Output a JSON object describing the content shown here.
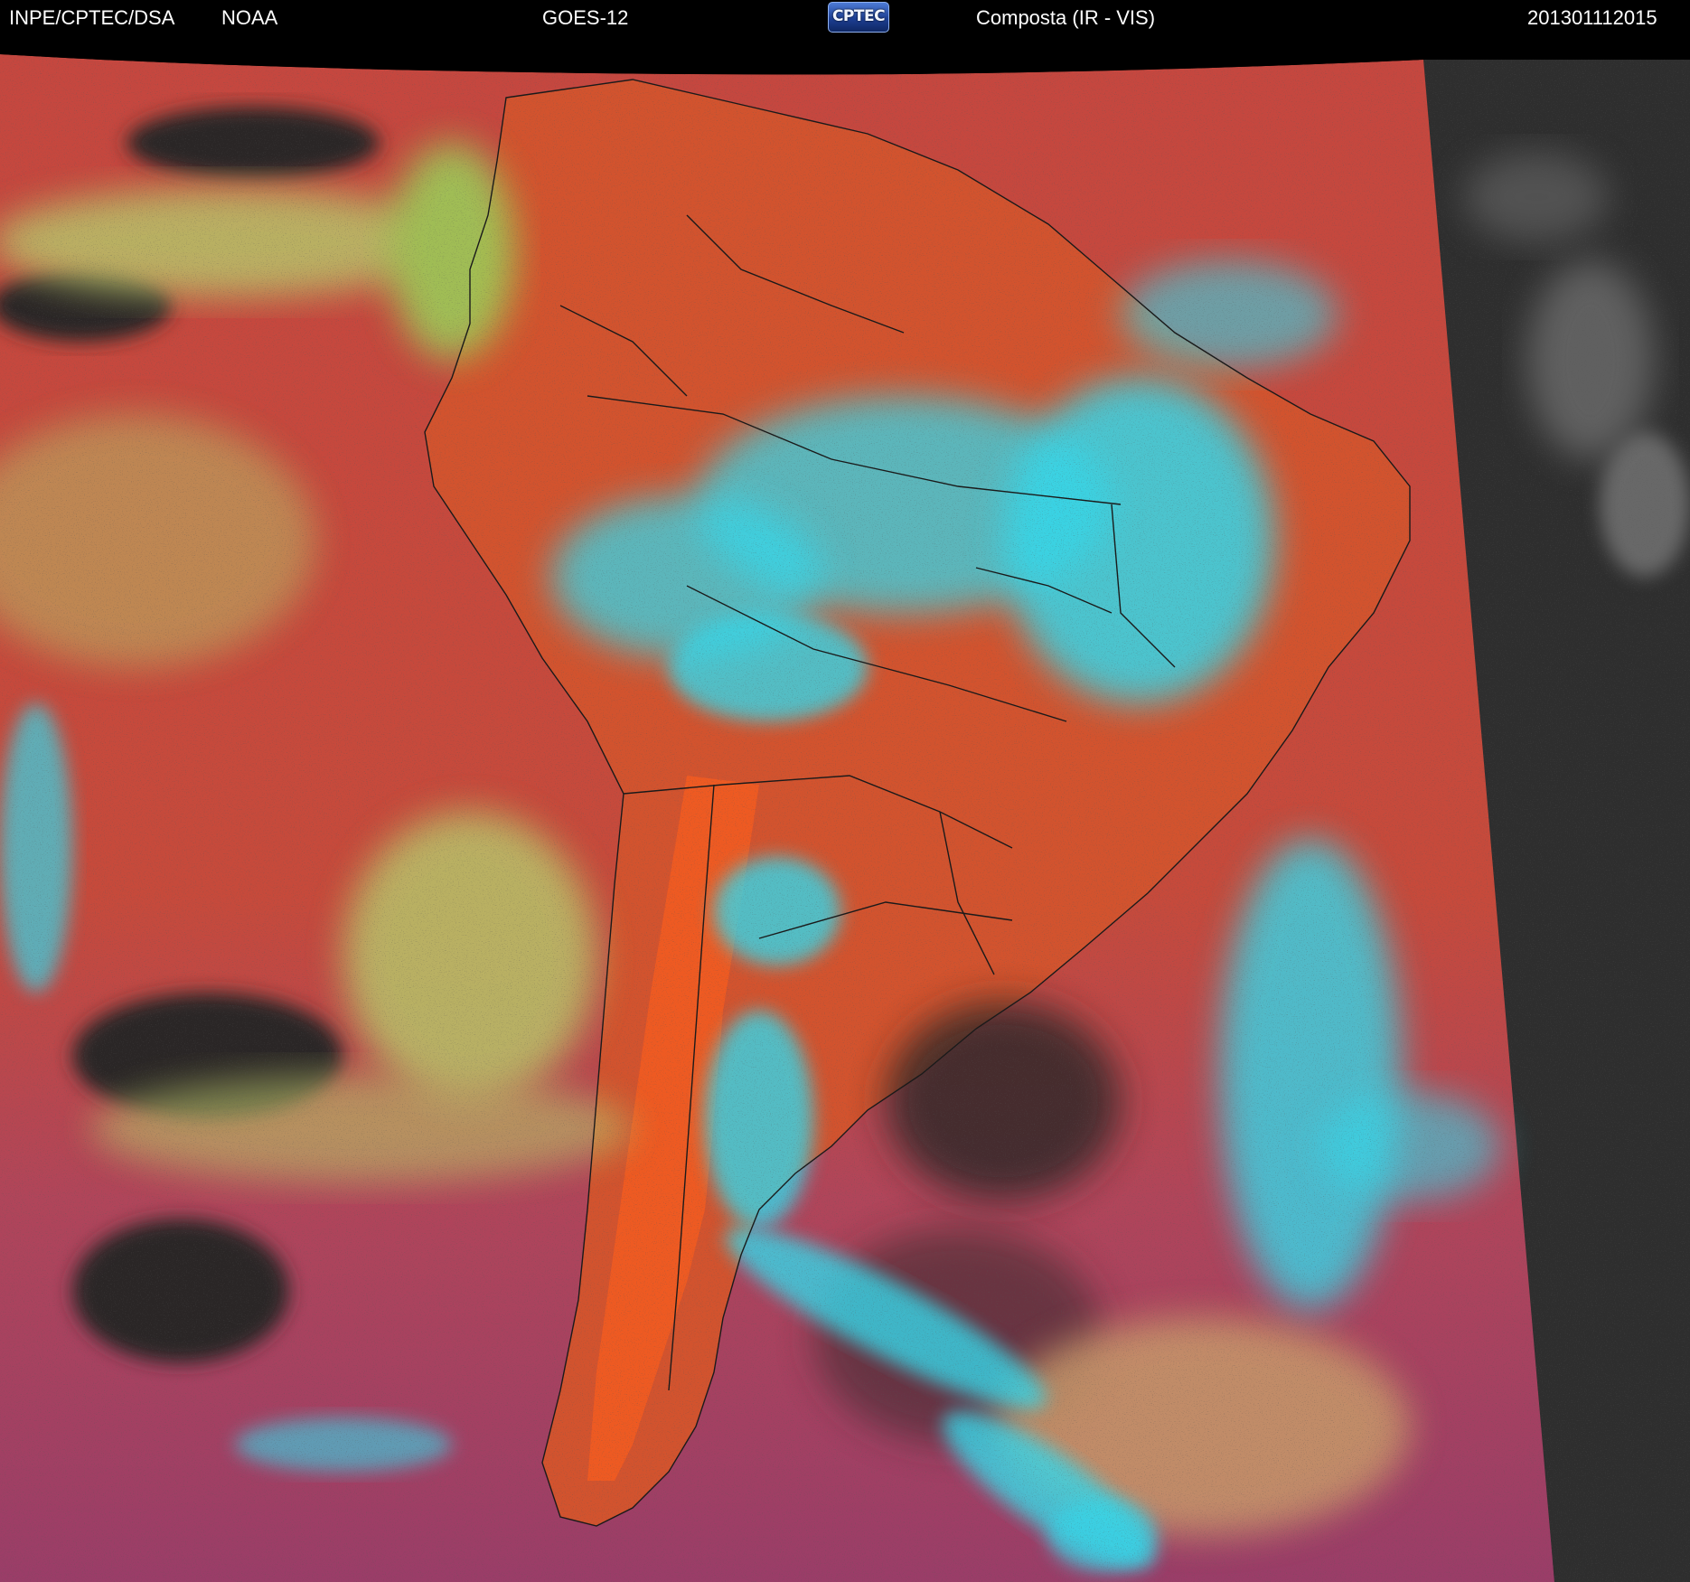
{
  "header": {
    "organization": "INPE/CPTEC/DSA",
    "agency": "NOAA",
    "satellite": "GOES-12",
    "logo_text": "CPTEC",
    "product": "Composta (IR - VIS)",
    "timestamp": "201301112015"
  },
  "palette": {
    "clear_ocean": "#c44a3e",
    "land_clear": "#d9542c",
    "cold_cloud": "#33d9e8",
    "mid_cloud": "#9ad35a",
    "low_cloud": "#c9c070",
    "dry_air": "#2a2424",
    "southern_ocean": "#a03f62",
    "outside_disk": "#2b2b2b",
    "borders": "#1a1a1a"
  },
  "icons": [
    "cptec-logo"
  ]
}
